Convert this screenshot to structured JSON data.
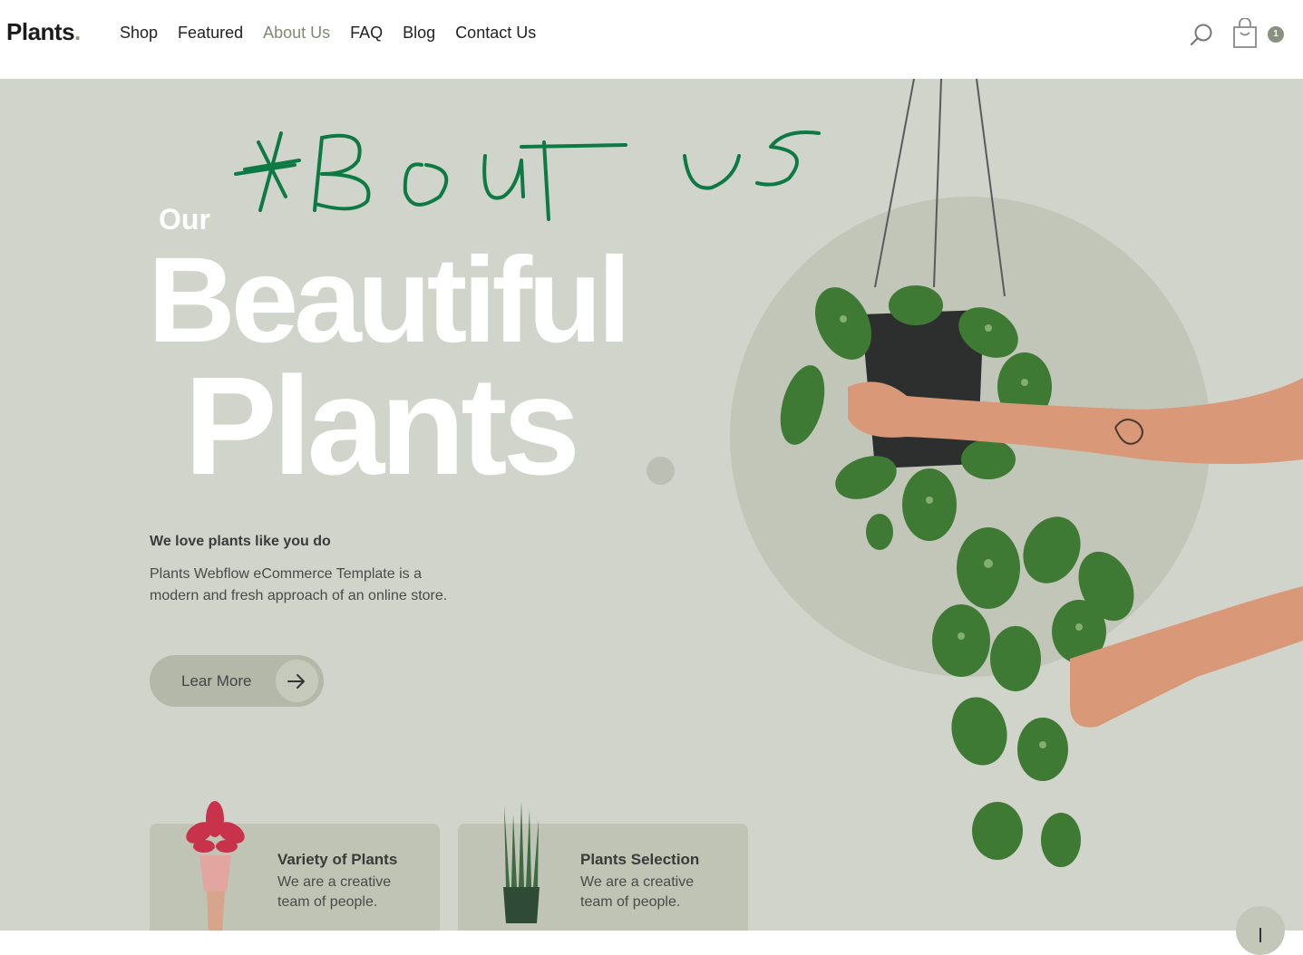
{
  "nav": {
    "logo": "Plants",
    "logo_dot": ".",
    "items": [
      {
        "label": "Shop",
        "active": false
      },
      {
        "label": "Featured",
        "active": false
      },
      {
        "label": "About Us",
        "active": true
      },
      {
        "label": "FAQ",
        "active": false
      },
      {
        "label": "Blog",
        "active": false
      },
      {
        "label": "Contact Us",
        "active": false
      }
    ],
    "cart_count": "1",
    "icons": {
      "search": "search-icon",
      "cart": "shopping-bag-icon"
    }
  },
  "hero": {
    "handwritten_note": "ABOUT US",
    "kicker": "Our",
    "title_line1": "Beautiful",
    "title_line2": "Plants",
    "subheading": "We love plants like you do",
    "description": "Plants Webflow eCommerce Template is a modern and fresh approach of an online store.",
    "cta_label": "Lear More",
    "cta_icon": "arrow-right-icon"
  },
  "cards": [
    {
      "title": "Variety of Plants",
      "text": "We are a creative team of people."
    },
    {
      "title": "Plants Selection",
      "text": "We are a creative team of people."
    }
  ],
  "colors": {
    "hero_bg": "#d1d4ca",
    "accent": "#7f8a71",
    "handwriting": "#0d7a45",
    "button": "#b3b8a9"
  }
}
